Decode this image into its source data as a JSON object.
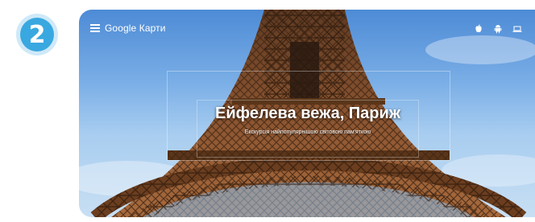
{
  "step": {
    "number": "2"
  },
  "header": {
    "app_title": "Google Карти"
  },
  "platforms": {
    "icons": [
      "apple-icon",
      "android-icon",
      "laptop-icon"
    ]
  },
  "hero": {
    "title": "Ейфелева вежа, Париж",
    "subtitle": "Екскурсія найпопулярнішою світовою пам'яткою"
  },
  "colors": {
    "badge": "#3aa8e0",
    "badge_ring": "#cfe9f8",
    "sky": "#4d8bd6",
    "tower": "#8a4e2a"
  }
}
